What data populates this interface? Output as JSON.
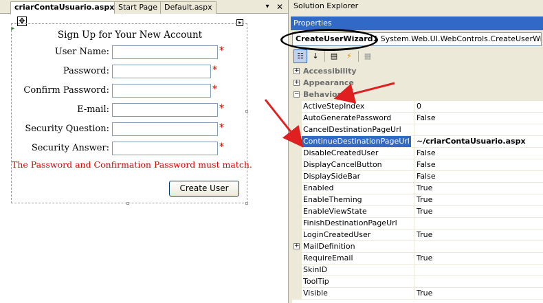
{
  "tabs": [
    {
      "label": "criarContaUsuario.aspx*",
      "active": true
    },
    {
      "label": "Start Page",
      "active": false
    },
    {
      "label": "Default.aspx",
      "active": false
    }
  ],
  "wizard": {
    "title": "Sign Up for Your New Account",
    "fields": [
      {
        "label": "User Name:",
        "value": ""
      },
      {
        "label": "Password:",
        "value": ""
      },
      {
        "label": "Confirm Password:",
        "value": ""
      },
      {
        "label": "E-mail:",
        "value": ""
      },
      {
        "label": "Security Question:",
        "value": ""
      },
      {
        "label": "Security Answer:",
        "value": ""
      }
    ],
    "required_marker": "*",
    "error_message": "The Password and Confirmation Password must match.",
    "create_button": "Create User"
  },
  "solution_explorer": {
    "title": "Solution Explorer"
  },
  "properties": {
    "title": "Properties",
    "object_name": "CreateUserWizard1",
    "object_type": " System.Web.UI.WebControls.CreateUserWizard",
    "rows": [
      {
        "type": "category",
        "name": "Accessibility",
        "expander": "+"
      },
      {
        "type": "category",
        "name": "Appearance",
        "expander": "+"
      },
      {
        "type": "category",
        "name": "Behavior",
        "expander": "−"
      },
      {
        "type": "prop",
        "name": "ActiveStepIndex",
        "value": "0"
      },
      {
        "type": "prop",
        "name": "AutoGeneratePassword",
        "value": "False"
      },
      {
        "type": "prop",
        "name": "CancelDestinationPageUrl",
        "value": ""
      },
      {
        "type": "prop",
        "name": "ContinueDestinationPageUrl",
        "value": "~/criarContaUsuario.aspx",
        "selected": true,
        "bold": true
      },
      {
        "type": "prop",
        "name": "DisableCreatedUser",
        "value": "False"
      },
      {
        "type": "prop",
        "name": "DisplayCancelButton",
        "value": "False"
      },
      {
        "type": "prop",
        "name": "DisplaySideBar",
        "value": "False"
      },
      {
        "type": "prop",
        "name": "Enabled",
        "value": "True"
      },
      {
        "type": "prop",
        "name": "EnableTheming",
        "value": "True"
      },
      {
        "type": "prop",
        "name": "EnableViewState",
        "value": "True"
      },
      {
        "type": "prop",
        "name": "FinishDestinationPageUrl",
        "value": ""
      },
      {
        "type": "prop",
        "name": "LoginCreatedUser",
        "value": "True"
      },
      {
        "type": "prop",
        "name": "MailDefinition",
        "value": "",
        "expander": "+"
      },
      {
        "type": "prop",
        "name": "RequireEmail",
        "value": "True"
      },
      {
        "type": "prop",
        "name": "SkinID",
        "value": ""
      },
      {
        "type": "prop",
        "name": "ToolTip",
        "value": ""
      },
      {
        "type": "prop",
        "name": "Visible",
        "value": "True"
      }
    ]
  },
  "colors": {
    "selection": "#316ac5",
    "error": "#e00000",
    "annotation": "#e02020"
  }
}
